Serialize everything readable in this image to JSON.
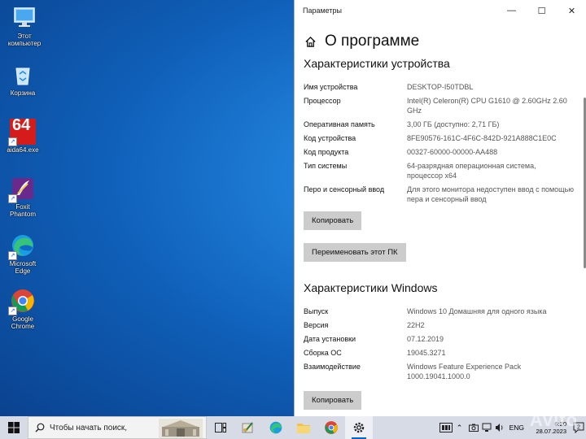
{
  "desktop": {
    "icons": [
      {
        "name": "this-pc",
        "label": "Этот\nкомпьютер"
      },
      {
        "name": "recycle-bin",
        "label": "Корзина"
      },
      {
        "name": "aida64",
        "label": "aida64.exe",
        "glyph": "64"
      },
      {
        "name": "foxit-phantom",
        "label": "Foxit\nPhantom"
      },
      {
        "name": "microsoft-edge",
        "label": "Microsoft\nEdge"
      },
      {
        "name": "google-chrome",
        "label": "Google\nChrome"
      }
    ]
  },
  "window": {
    "title": "Параметры",
    "controls": {
      "minimize": "—",
      "maximize": "☐",
      "close": "✕"
    },
    "page_title": "О программе",
    "device_section": {
      "title": "Характеристики устройства",
      "rows": [
        {
          "k": "Имя устройства",
          "v": "DESKTOP-I50TDBL"
        },
        {
          "k": "Процессор",
          "v": "Intel(R) Celeron(R) CPU G1610 @ 2.60GHz   2.60 GHz"
        },
        {
          "k": "Оперативная память",
          "v": "3,00 ГБ (доступно: 2,71 ГБ)"
        },
        {
          "k": "Код устройства",
          "v": "8FE90576-161C-4F6C-842D-921A888C1E0C"
        },
        {
          "k": "Код продукта",
          "v": "00327-60000-00000-AA488"
        },
        {
          "k": "Тип системы",
          "v": "64-разрядная операционная система, процессор x64"
        },
        {
          "k": "Перо и сенсорный ввод",
          "v": "Для этого монитора недоступен ввод с помощью пера и сенсорный ввод"
        }
      ],
      "copy_button": "Копировать",
      "rename_button": "Переименовать этот ПК"
    },
    "windows_section": {
      "title": "Характеристики Windows",
      "rows": [
        {
          "k": "Выпуск",
          "v": "Windows 10 Домашняя для одного языка"
        },
        {
          "k": "Версия",
          "v": "22H2"
        },
        {
          "k": "Дата установки",
          "v": "07.12.2019"
        },
        {
          "k": "Сборка ОС",
          "v": "19045.3271"
        },
        {
          "k": "Взаимодействие",
          "v": "Windows Feature Experience Pack 1000.19041.1000.0"
        }
      ],
      "copy_button": "Копировать"
    }
  },
  "taskbar": {
    "search_placeholder": "Чтобы начать поиск,",
    "lang": "ENG",
    "date": "28.07.2023",
    "time": "6:20",
    "notification_count": "2"
  },
  "watermark": "Avito",
  "colors": {
    "accent": "#0a63c9",
    "button_bg": "#cccccc",
    "taskbar_bg": "#d7dbe6"
  }
}
